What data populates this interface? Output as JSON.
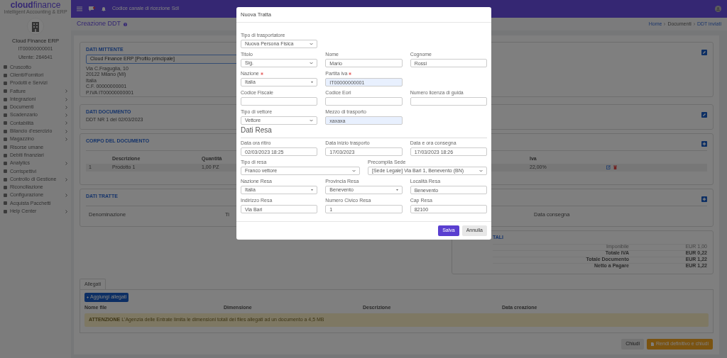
{
  "sidebar": {
    "brand": "**cloud**finance",
    "tagline": "Intelligent Accounting & ERP",
    "company": "Cloud Finance ERP",
    "vat": "IT00000000001",
    "user": "Utente: 264641",
    "items": [
      {
        "label": "Cruscotto",
        "submenu": false
      },
      {
        "label": "Clienti/Fornitori",
        "submenu": false
      },
      {
        "label": "Prodotti e Servizi",
        "submenu": false
      },
      {
        "label": "Fatture",
        "submenu": true
      },
      {
        "label": "Integrazioni",
        "submenu": true
      },
      {
        "label": "Documenti",
        "submenu": true
      },
      {
        "label": "Scadenzario",
        "submenu": true
      },
      {
        "label": "Contabilità",
        "submenu": true
      },
      {
        "label": "Bilancio d'esercizio",
        "submenu": true
      },
      {
        "label": "Magazzino",
        "submenu": true
      },
      {
        "label": "Risorse umane",
        "submenu": false
      },
      {
        "label": "Debiti finanziari",
        "submenu": false
      },
      {
        "label": "Analytics",
        "submenu": true
      },
      {
        "label": "Corrispettivi",
        "submenu": false
      },
      {
        "label": "Controllo di Gestione",
        "submenu": true
      },
      {
        "label": "Riconciliazione",
        "submenu": false
      },
      {
        "label": "Configurazione",
        "submenu": true
      },
      {
        "label": "Acquista Pacchetti",
        "submenu": false
      },
      {
        "label": "Help Center",
        "submenu": true
      }
    ]
  },
  "topbar": {
    "sdi_label": "Codice canale di ricezione SdI"
  },
  "page": {
    "title": "Creazione DDT",
    "breadcrumb": [
      "Home",
      "Documenti",
      "DDT inviati"
    ]
  },
  "mittente": {
    "title": "DATI MITTENTE",
    "profile": "Cloud Finance ERP [Profilo principale]",
    "address": [
      "Via C.Fraguglia, 10",
      "20122 Milano (MI)",
      "Italia",
      "C.F. 00000000001",
      "P.IVA IT00000000001"
    ]
  },
  "documento": {
    "title": "DATI DOCUMENTO",
    "text": "DDT NR 1 del 02/03/2023"
  },
  "corpo": {
    "title": "CORPO DEL DOCUMENTO",
    "columns": [
      "Descrizione",
      "Quantità",
      "Iva"
    ],
    "rows": [
      {
        "number": "1",
        "cells": [
          "Prodotto 1",
          "1,00 PZ",
          "22,00%"
        ]
      }
    ]
  },
  "tratte": {
    "title": "DATI TRATTE",
    "columns": [
      "Denominazione",
      "Ti",
      "Data consegna"
    ]
  },
  "totali": {
    "title": "TALI",
    "rows": [
      {
        "label": "Imponibile",
        "value": "EUR 1,00",
        "bold": false
      },
      {
        "label": "Totale IVA",
        "value": "EUR 0,22",
        "bold": true
      },
      {
        "label": "Totale Documento",
        "value": "EUR 1,22",
        "bold": true
      },
      {
        "label": "Netto a Pagare",
        "value": "EUR 1,22",
        "bold": true
      }
    ]
  },
  "allegati": {
    "tabs": [
      {
        "label": "Allegati",
        "selected": true
      }
    ],
    "add_button": "Aggiungi allegati",
    "columns": [
      "Nome file",
      "Dimensione",
      "Descrizione",
      "Data creazione"
    ],
    "alert": "**ATTENZIONE** L'Agenzia delle Entrate limita le dimensioni totali dei files allegati ad un documento a 4,5 MB"
  },
  "footer_buttons": [
    {
      "kind": "secondary",
      "label": "Chiudi"
    },
    {
      "kind": "warning",
      "label": "Rendi definitivo e chiudi"
    }
  ],
  "modal": {
    "title": "Nuova Tratta",
    "sections": [
      {
        "rows": [
          {
            "kind": "third",
            "fields": [
              {
                "kind": "select",
                "label": "Tipo di trasportatore",
                "value": "Nuova Persona Fisica",
                "required": false,
                "autofilled": false
              }
            ]
          },
          {
            "kind": "third",
            "fields": [
              {
                "kind": "select",
                "label": "Titolo",
                "value": "Sig.",
                "required": false,
                "autofilled": false
              },
              {
                "kind": "input",
                "label": "Nome",
                "value": "Mario",
                "required": false,
                "autofilled": false
              },
              {
                "kind": "input",
                "label": "Cognome",
                "value": "Rossi",
                "required": false,
                "autofilled": false
              }
            ]
          },
          {
            "kind": "third",
            "fields": [
              {
                "kind": "combo",
                "label": "Nazione",
                "value": "Italia",
                "required": true,
                "autofilled": false
              },
              {
                "kind": "input",
                "label": "Partita iva",
                "value": "IT00000000001",
                "required": true,
                "autofilled": true
              }
            ]
          },
          {
            "kind": "third",
            "fields": [
              {
                "kind": "input",
                "label": "Codice Fiscale",
                "required": false,
                "autofilled": false
              },
              {
                "kind": "input",
                "label": "Codice Eori",
                "required": false,
                "autofilled": false
              },
              {
                "kind": "input",
                "label": "Numero licenza di guida",
                "required": false,
                "autofilled": false
              }
            ]
          },
          {
            "kind": "third",
            "fields": [
              {
                "kind": "select",
                "label": "Tipo di vettore",
                "value": "Vettore",
                "required": false,
                "autofilled": false
              },
              {
                "kind": "input",
                "label": "Mezzo di trasporto",
                "value": "xaxaxa",
                "required": false,
                "autofilled": true
              }
            ]
          }
        ]
      },
      {
        "title": "Dati Resa",
        "rows": [
          {
            "kind": "third",
            "fields": [
              {
                "kind": "input",
                "label": "Data ora ritiro",
                "value": "02/03/2023 18:25",
                "required": false,
                "autofilled": false
              },
              {
                "kind": "input",
                "label": "Data inizio trasporto",
                "value": "17/03/2023",
                "required": false,
                "autofilled": false
              },
              {
                "kind": "input",
                "label": "Data e ora consegna",
                "value": "17/03/2023 18:26",
                "required": false,
                "autofilled": false
              }
            ]
          },
          {
            "kind": "half",
            "fields": [
              {
                "kind": "select",
                "label": "Tipo di resa",
                "value": "Franco vettore",
                "required": false,
                "autofilled": false
              },
              {
                "kind": "select",
                "label": "Precompila Sede",
                "value": "[Sede Legale] Via Bari 1, Benevento (BN)",
                "required": false,
                "autofilled": false
              }
            ]
          },
          {
            "kind": "third",
            "fields": [
              {
                "kind": "combo",
                "label": "Nazione Resa",
                "value": "Italia",
                "required": false,
                "autofilled": false
              },
              {
                "kind": "combo",
                "label": "Provincia Resa",
                "value": "Benevento",
                "required": false,
                "autofilled": false
              },
              {
                "kind": "input",
                "label": "Località Resa",
                "value": "Benevento",
                "required": false,
                "autofilled": false
              }
            ]
          },
          {
            "kind": "third",
            "fields": [
              {
                "kind": "input",
                "label": "Indirizzo Resa",
                "value": "Via Bari",
                "required": false,
                "autofilled": false
              },
              {
                "kind": "input",
                "label": "Numero Civico Resa",
                "value": "1",
                "required": false,
                "autofilled": false
              },
              {
                "kind": "input",
                "label": "Cap Resa",
                "value": "82100",
                "required": false,
                "autofilled": false
              }
            ]
          }
        ]
      }
    ],
    "buttons": [
      {
        "kind": "primary",
        "label": "Salva"
      },
      {
        "kind": "secondary",
        "label": "Annulla"
      }
    ]
  }
}
